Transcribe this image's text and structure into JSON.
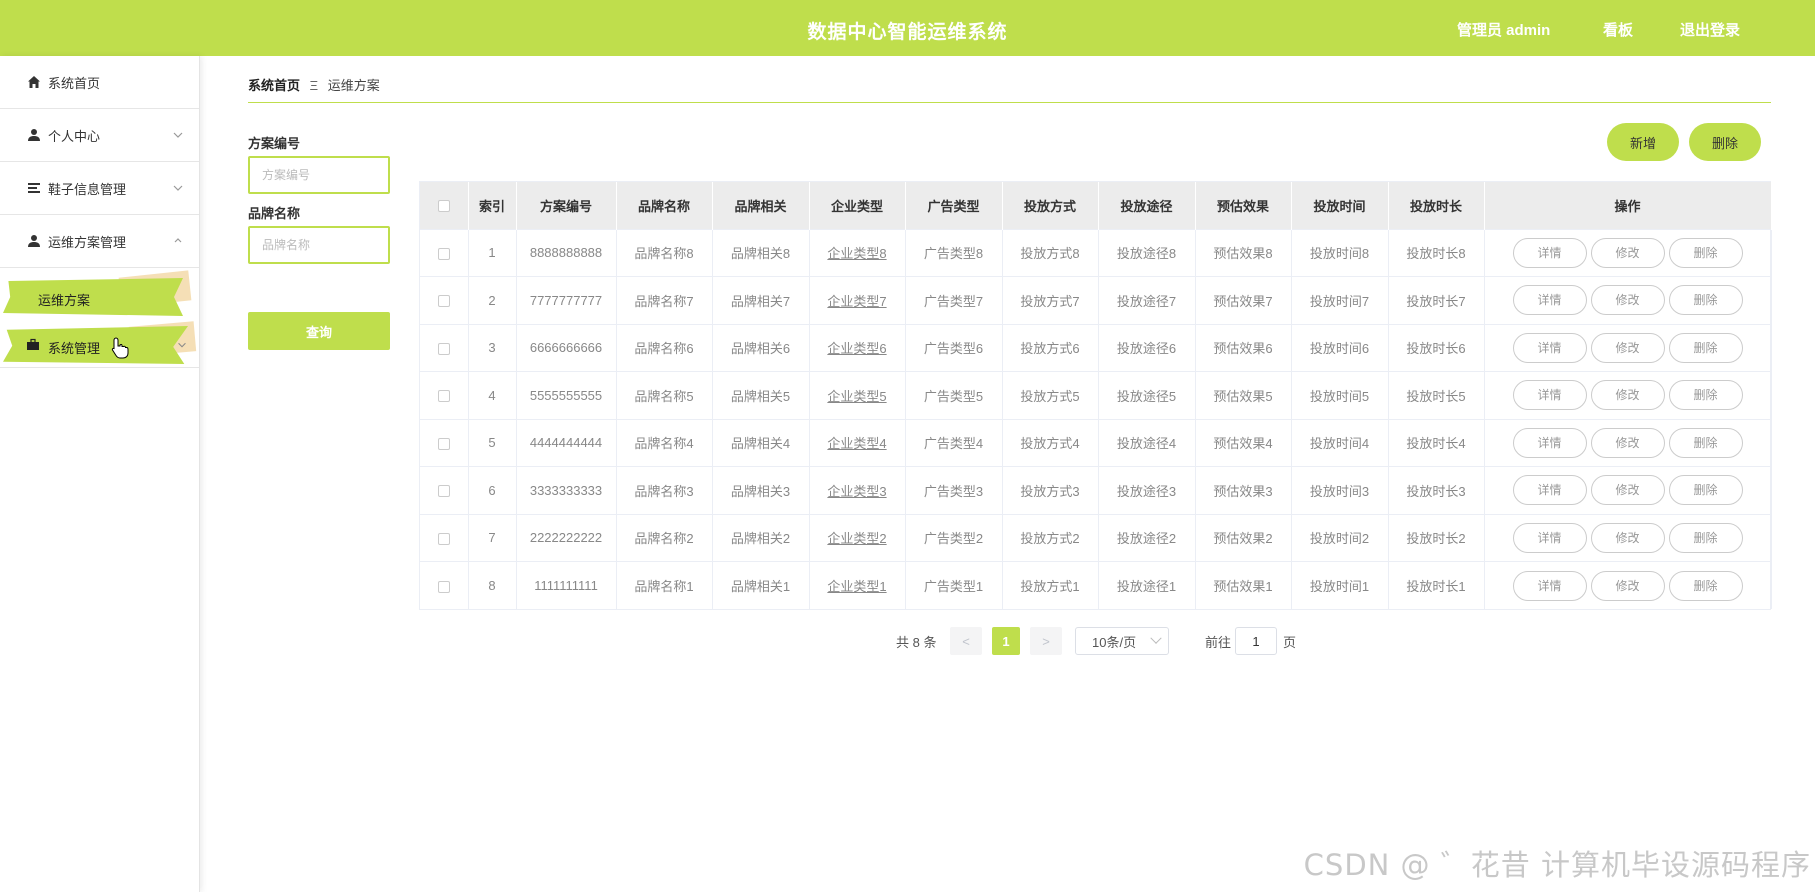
{
  "header": {
    "title": "数据中心智能运维系统",
    "admin_label": "管理员 admin",
    "board_label": "看板",
    "logout_label": "退出登录"
  },
  "sidebar": {
    "home": "系统首页",
    "personal": "个人中心",
    "shoes": "鞋子信息管理",
    "ops_plan_mgmt": "运维方案管理",
    "ops_plan": "运维方案",
    "system_mgmt": "系统管理"
  },
  "breadcrumb": {
    "home": "系统首页",
    "current": "运维方案"
  },
  "filters": {
    "plan_no_label": "方案编号",
    "plan_no_placeholder": "方案编号",
    "brand_label": "品牌名称",
    "brand_placeholder": "品牌名称",
    "query_label": "查询"
  },
  "actions": {
    "add_label": "新增",
    "delete_label": "删除"
  },
  "table": {
    "headers": [
      "索引",
      "方案编号",
      "品牌名称",
      "品牌相关",
      "企业类型",
      "广告类型",
      "投放方式",
      "投放途径",
      "预估效果",
      "投放时间",
      "投放时长",
      "操作"
    ],
    "op_labels": [
      "详情",
      "修改",
      "删除"
    ],
    "rows": [
      [
        "1",
        "8888888888",
        "品牌名称8",
        "品牌相关8",
        "企业类型8",
        "广告类型8",
        "投放方式8",
        "投放途径8",
        "预估效果8",
        "投放时间8",
        "投放时长8"
      ],
      [
        "2",
        "7777777777",
        "品牌名称7",
        "品牌相关7",
        "企业类型7",
        "广告类型7",
        "投放方式7",
        "投放途径7",
        "预估效果7",
        "投放时间7",
        "投放时长7"
      ],
      [
        "3",
        "6666666666",
        "品牌名称6",
        "品牌相关6",
        "企业类型6",
        "广告类型6",
        "投放方式6",
        "投放途径6",
        "预估效果6",
        "投放时间6",
        "投放时长6"
      ],
      [
        "4",
        "5555555555",
        "品牌名称5",
        "品牌相关5",
        "企业类型5",
        "广告类型5",
        "投放方式5",
        "投放途径5",
        "预估效果5",
        "投放时间5",
        "投放时长5"
      ],
      [
        "5",
        "4444444444",
        "品牌名称4",
        "品牌相关4",
        "企业类型4",
        "广告类型4",
        "投放方式4",
        "投放途径4",
        "预估效果4",
        "投放时间4",
        "投放时长4"
      ],
      [
        "6",
        "3333333333",
        "品牌名称3",
        "品牌相关3",
        "企业类型3",
        "广告类型3",
        "投放方式3",
        "投放途径3",
        "预估效果3",
        "投放时间3",
        "投放时长3"
      ],
      [
        "7",
        "2222222222",
        "品牌名称2",
        "品牌相关2",
        "企业类型2",
        "广告类型2",
        "投放方式2",
        "投放途径2",
        "预估效果2",
        "投放时间2",
        "投放时长2"
      ],
      [
        "8",
        "1111111111",
        "品牌名称1",
        "品牌相关1",
        "企业类型1",
        "广告类型1",
        "投放方式1",
        "投放途径1",
        "预估效果1",
        "投放时间1",
        "投放时长1"
      ]
    ]
  },
  "pagination": {
    "total": "共 8 条",
    "prev": "<",
    "current": "1",
    "next": ">",
    "page_size": "10条/页",
    "goto": "前往",
    "goto_value": "1",
    "page_suffix": "页"
  },
  "watermark": "CSDN @ ゛花昔 计算机毕设源码程序",
  "colors": {
    "accent": "#bfde4c",
    "header_text": "#ffffff"
  }
}
